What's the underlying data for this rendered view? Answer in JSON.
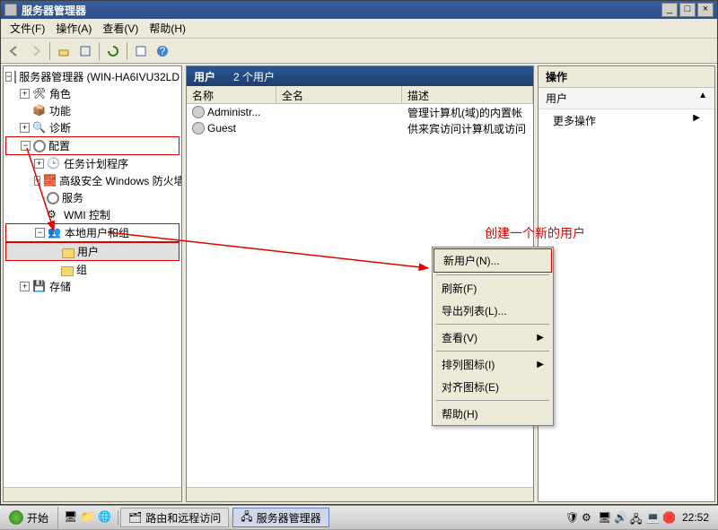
{
  "window": {
    "title": "服务器管理器"
  },
  "menubar": {
    "file": "文件(F)",
    "action": "操作(A)",
    "view": "查看(V)",
    "help": "帮助(H)"
  },
  "tree": {
    "root": "服务器管理器 (WIN-HA6IVU32LD",
    "roles": "角色",
    "features": "功能",
    "diagnostics": "诊断",
    "config": "配置",
    "taskScheduler": "任务计划程序",
    "firewall": "高级安全 Windows 防火墙",
    "services": "服务",
    "wmi": "WMI 控制",
    "localUsers": "本地用户和组",
    "users": "用户",
    "groups": "组",
    "storage": "存储"
  },
  "midHeader": {
    "title": "用户",
    "count": "2 个用户"
  },
  "columns": {
    "name": "名称",
    "fullname": "全名",
    "desc": "描述"
  },
  "users": [
    {
      "name": "Administr...",
      "fullname": "",
      "desc": "管理计算机(域)的内置帐"
    },
    {
      "name": "Guest",
      "fullname": "",
      "desc": "供来宾访问计算机或访问"
    }
  ],
  "actions": {
    "title": "操作",
    "sub": "用户",
    "more": "更多操作"
  },
  "contextMenu": {
    "newUser": "新用户(N)...",
    "refresh": "刷新(F)",
    "exportList": "导出列表(L)...",
    "view": "查看(V)",
    "arrangeIcons": "排列图标(I)",
    "alignIcons": "对齐图标(E)",
    "help": "帮助(H)"
  },
  "annotation": "创建一个新的用户",
  "taskbar": {
    "start": "开始",
    "item1": "路由和远程访问",
    "item2": "服务器管理器",
    "clock": "22:52"
  }
}
